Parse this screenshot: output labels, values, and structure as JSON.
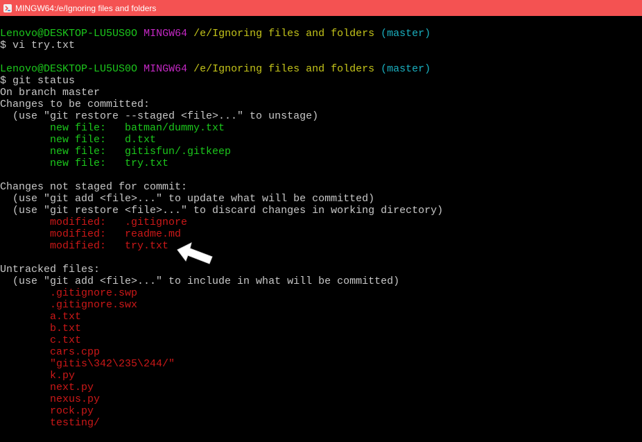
{
  "window": {
    "title": "MINGW64:/e/Ignoring files and folders",
    "titlebar_color": "#f45252",
    "icon": "git-bash-icon"
  },
  "colors": {
    "background": "#000000",
    "text": "#c0c0c0",
    "green": "#1cc81c",
    "magenta": "#c428c4",
    "yellow": "#c4c41a",
    "cyan": "#1ab0c0",
    "red": "#cc1818"
  },
  "prompt": {
    "user_host": "Lenovo@DESKTOP-LU5US0O",
    "shell": "MINGW64",
    "path": "/e/Ignoring files and folders",
    "branch": "(master)"
  },
  "commands": {
    "first": "$ vi try.txt",
    "second": "$ git status"
  },
  "status": {
    "branch_line": "On branch master",
    "staged_header": "Changes to be committed:",
    "staged_hint": "  (use \"git restore --staged <file>...\" to unstage)",
    "staged": [
      "        new file:   batman/dummy.txt",
      "        new file:   d.txt",
      "        new file:   gitisfun/.gitkeep",
      "        new file:   try.txt"
    ],
    "unstaged_header": "Changes not staged for commit:",
    "unstaged_hint1": "  (use \"git add <file>...\" to update what will be committed)",
    "unstaged_hint2": "  (use \"git restore <file>...\" to discard changes in working directory)",
    "unstaged": [
      "        modified:   .gitignore",
      "        modified:   readme.md",
      "        modified:   try.txt"
    ],
    "untracked_header": "Untracked files:",
    "untracked_hint": "  (use \"git add <file>...\" to include in what will be committed)",
    "untracked": [
      "        .gitignore.swp",
      "        .gitignore.swx",
      "        a.txt",
      "        b.txt",
      "        c.txt",
      "        cars.cpp",
      "        \"gitis\\342\\235\\244/\"",
      "        k.py",
      "        next.py",
      "        nexus.py",
      "        rock.py",
      "        testing/"
    ]
  },
  "annotation": {
    "icon": "pointer-arrow-icon"
  }
}
